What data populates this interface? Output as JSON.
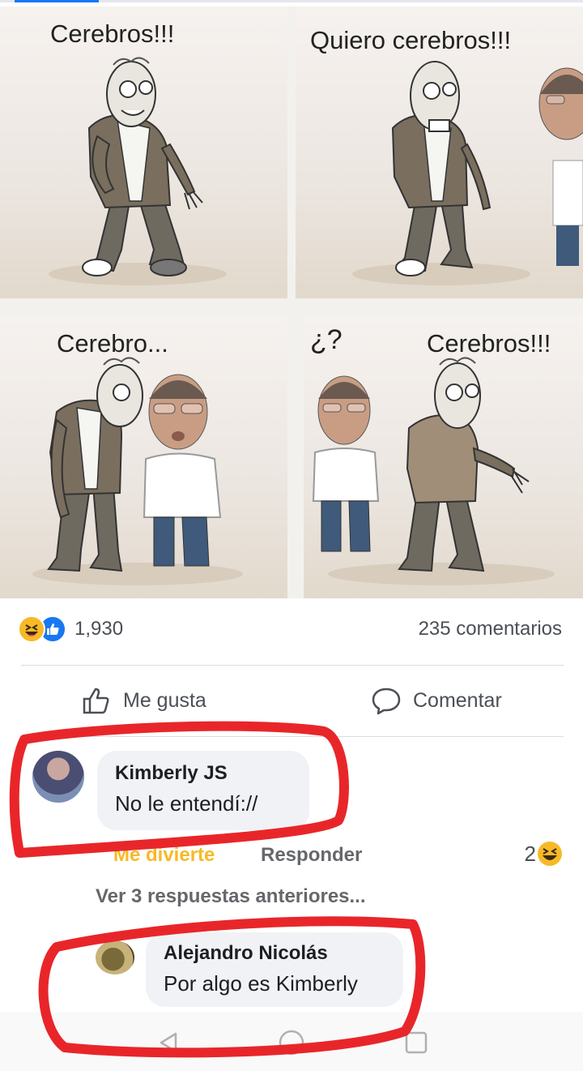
{
  "meme": {
    "panels": [
      {
        "caption": "Cerebros!!!"
      },
      {
        "caption": "Quiero cerebros!!!"
      },
      {
        "caption": "Cerebro..."
      },
      {
        "caption_left": "¿?",
        "caption_right": "Cerebros!!!"
      }
    ]
  },
  "post": {
    "reactions_count": "1,930",
    "comments_count": "235 comentarios",
    "like_label": "Me gusta",
    "comment_label": "Comentar"
  },
  "comments": [
    {
      "author": "Kimberly JS",
      "text": "No le entendí://",
      "reaction_label": "Me divierte",
      "reply_label": "Responder",
      "reaction_count": "2"
    }
  ],
  "more_replies": "Ver 3 respuestas anteriores...",
  "reply": {
    "author": "Alejandro Nicolás",
    "text": "Por algo es Kimberly"
  },
  "colors": {
    "brand_blue": "#1877f2",
    "haha_yellow": "#f7b928",
    "marker_red": "#e8262a",
    "bubble_gray": "#f0f2f5"
  },
  "icons": [
    "haha-emoji-icon",
    "like-reaction-icon",
    "thumbs-up-icon",
    "comment-icon",
    "back-icon",
    "home-icon",
    "recents-icon"
  ]
}
